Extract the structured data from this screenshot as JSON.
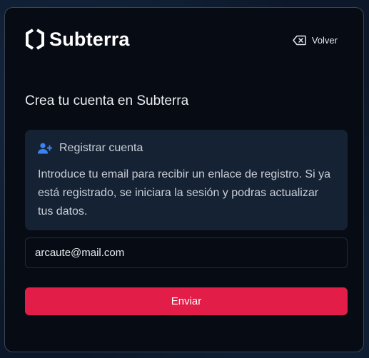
{
  "brand": {
    "name": "Subterra",
    "logo_icon": "hexagon-brackets-icon"
  },
  "header": {
    "back_label": "Volver",
    "back_icon": "backspace-icon"
  },
  "main": {
    "heading": "Crea tu cuenta en Subterra",
    "info": {
      "icon": "user-plus-icon",
      "title": "Registrar cuenta",
      "body": "Introduce tu email para recibir un enlace de registro. Si ya está registrado, se iniciara la sesión y podras actualizar tus datos."
    },
    "email": {
      "value": "arcaute@mail.com"
    },
    "submit_label": "Enviar"
  },
  "colors": {
    "accent": "#e11d48",
    "card_bg": "#070c14",
    "info_bg": "#152233",
    "icon_blue": "#3b82f6"
  }
}
